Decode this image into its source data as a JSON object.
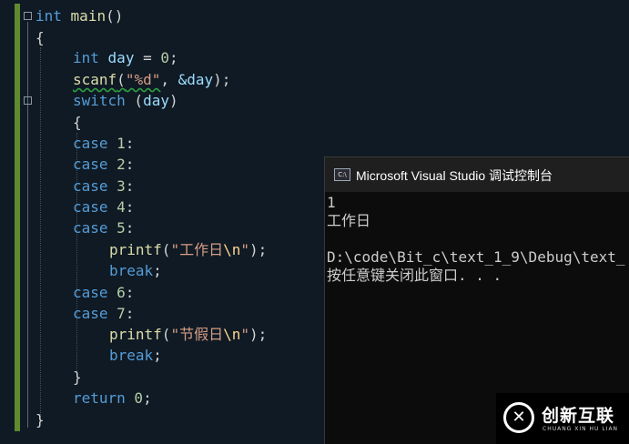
{
  "editor": {
    "fold_main": "⊟",
    "fold_switch": "⊟",
    "lines": {
      "l1": {
        "kw": "int",
        "name": "main",
        "rest": "()"
      },
      "l2": {
        "text": "{"
      },
      "l3": {
        "kw": "int",
        "id": "day",
        "op": " = ",
        "num": "0",
        "end": ";"
      },
      "l4": {
        "fn": "scanf",
        "open": "(",
        "str": "\"%d\"",
        "mid": ", ",
        "ref": "&day",
        "close": ");"
      },
      "l5": {
        "kw": "switch",
        "open": " (",
        "id": "day",
        "close": ")"
      },
      "l6": {
        "text": "{"
      },
      "l7": {
        "kw": "case",
        "num": " 1",
        "end": ":"
      },
      "l8": {
        "kw": "case",
        "num": " 2",
        "end": ":"
      },
      "l9": {
        "kw": "case",
        "num": " 3",
        "end": ":"
      },
      "l10": {
        "kw": "case",
        "num": " 4",
        "end": ":"
      },
      "l11": {
        "kw": "case",
        "num": " 5",
        "end": ":"
      },
      "l12": {
        "fn": "printf",
        "open": "(",
        "str": "\"工作日",
        "esc": "\\n",
        "str2": "\"",
        "close": ");"
      },
      "l13": {
        "kw": "break",
        "end": ";"
      },
      "l14": {
        "kw": "case",
        "num": " 6",
        "end": ":"
      },
      "l15": {
        "kw": "case",
        "num": " 7",
        "end": ":"
      },
      "l16": {
        "fn": "printf",
        "open": "(",
        "str": "\"节假日",
        "esc": "\\n",
        "str2": "\"",
        "close": ");"
      },
      "l17": {
        "kw": "break",
        "end": ";"
      },
      "l18": {
        "text": "}"
      },
      "l19": {
        "kw": "return",
        "num": " 0",
        "end": ";"
      },
      "l20": {
        "text": "}"
      }
    }
  },
  "console": {
    "icon": "C:\\",
    "title": "Microsoft Visual Studio 调试控制台",
    "output": [
      "1",
      "工作日",
      "",
      "D:\\code\\Bit_c\\text_1_9\\Debug\\text_",
      "按任意键关闭此窗口. . ."
    ]
  },
  "watermark": {
    "logo": "✕",
    "title": "创新互联",
    "subtitle": "CHUANG XIN HU LIAN"
  }
}
